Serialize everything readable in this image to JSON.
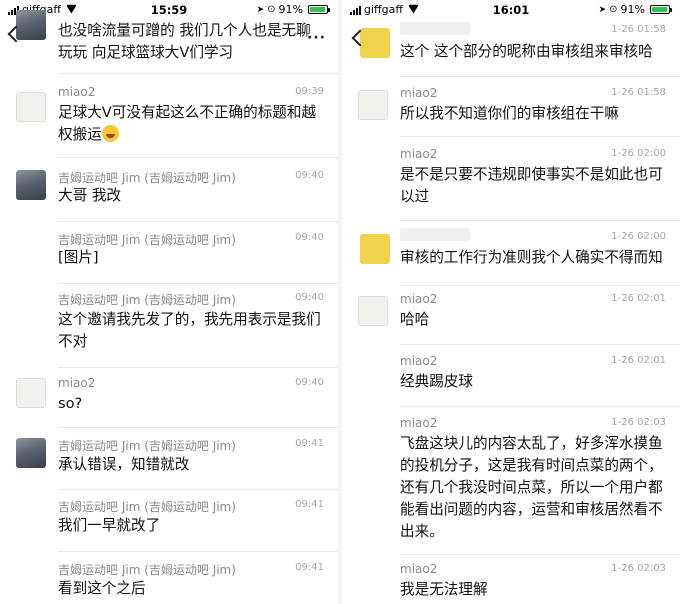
{
  "left": {
    "status": {
      "carrier": "giffgaff",
      "time": "15:59",
      "battery": "91%",
      "battery_level": 0.91
    },
    "messages": [
      {
        "name": "",
        "time": "",
        "text": "也没啥流量可蹭的 我们几个人也是无聊玩玩 向足球篮球大V们学习",
        "avatar": "jim"
      },
      {
        "name": "miao2",
        "time": "09:39",
        "text": "足球大V可没有起这么不正确的标题和越权搬运",
        "avatar": "miao",
        "emoji": "sweat-smile-icon"
      },
      {
        "name": "吉姆运动吧 Jim (吉姆运动吧 Jim)",
        "time": "09:40",
        "text": "大哥 我改",
        "avatar": "jim"
      },
      {
        "name": "吉姆运动吧 Jim (吉姆运动吧 Jim)",
        "time": "09:40",
        "text": "[图片]",
        "avatar": ""
      },
      {
        "name": "吉姆运动吧 Jim (吉姆运动吧 Jim)",
        "time": "09:40",
        "text": "这个邀请我先发了的，我先用表示是我们不对",
        "avatar": ""
      },
      {
        "name": "miao2",
        "time": "09:40",
        "text": "so?",
        "avatar": "miao"
      },
      {
        "name": "吉姆运动吧 Jim (吉姆运动吧 Jim)",
        "time": "09:41",
        "text": "承认错误，知错就改",
        "avatar": "jim"
      },
      {
        "name": "吉姆运动吧 Jim (吉姆运动吧 Jim)",
        "time": "09:41",
        "text": "我们一早就改了",
        "avatar": ""
      },
      {
        "name": "吉姆运动吧 Jim (吉姆运动吧 Jim)",
        "time": "09:41",
        "text": "看到这个之后",
        "avatar": ""
      }
    ]
  },
  "right": {
    "status": {
      "carrier": "giffgaff",
      "time": "16:01",
      "battery": "91%",
      "battery_level": 0.91
    },
    "messages": [
      {
        "name": "",
        "time": "1-26 01:58",
        "text": "这个 这个部分的昵称由审核组来审核哈",
        "avatar": "yellow"
      },
      {
        "name": "miao2",
        "time": "1-26 01:58",
        "text": "所以我不知道你们的审核组在干嘛",
        "avatar": "miao"
      },
      {
        "name": "miao2",
        "time": "1-26 02:00",
        "text": "是不是只要不违规即使事实不是如此也可以过",
        "avatar": ""
      },
      {
        "name": "",
        "time": "1-26 02:00",
        "text": "审核的工作行为准则我个人确实不得而知",
        "avatar": "yellow"
      },
      {
        "name": "miao2",
        "time": "1-26 02:01",
        "text": "哈哈",
        "avatar": "miao"
      },
      {
        "name": "miao2",
        "time": "1-26 02:01",
        "text": "经典踢皮球",
        "avatar": ""
      },
      {
        "name": "miao2",
        "time": "1-26 02:03",
        "text": "飞盘这块儿的内容太乱了，好多浑水摸鱼的投机分子，这是我有时间点菜的两个，还有几个我没时间点菜，所以一个用户都能看出问题的内容，运营和审核居然看不出来。",
        "avatar": ""
      },
      {
        "name": "miao2",
        "time": "1-26 02:03",
        "text": "我是无法理解",
        "avatar": ""
      }
    ]
  }
}
